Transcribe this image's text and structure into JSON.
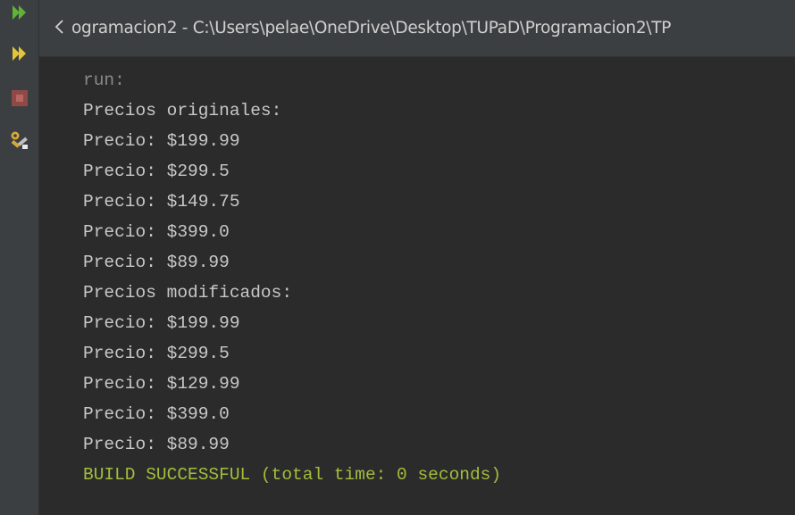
{
  "toolbar": {
    "buttons": [
      {
        "name": "rerun-icon",
        "color": "#5fb336"
      },
      {
        "name": "rerun-with-arguments-icon",
        "color": "#e2c53b"
      },
      {
        "name": "stop-icon",
        "color": "#c75450"
      },
      {
        "name": "settings-tools-icon",
        "color": "#d6a93a"
      }
    ]
  },
  "tab": {
    "title": "ogramacion2 - C:\\Users\\pelae\\OneDrive\\Desktop\\TUPaD\\Programacion2\\TP",
    "chevron_icon": "chevron-left-icon"
  },
  "output": {
    "lines": [
      {
        "text": "run:",
        "kind": "muted"
      },
      {
        "text": "Precios originales:",
        "kind": "std"
      },
      {
        "text": "Precio: $199.99",
        "kind": "std"
      },
      {
        "text": "Precio: $299.5",
        "kind": "std"
      },
      {
        "text": "Precio: $149.75",
        "kind": "std"
      },
      {
        "text": "Precio: $399.0",
        "kind": "std"
      },
      {
        "text": "Precio: $89.99",
        "kind": "std"
      },
      {
        "text": "Precios modificados:",
        "kind": "std"
      },
      {
        "text": "Precio: $199.99",
        "kind": "std"
      },
      {
        "text": "Precio: $299.5",
        "kind": "std"
      },
      {
        "text": "Precio: $129.99",
        "kind": "std"
      },
      {
        "text": "Precio: $399.0",
        "kind": "std"
      },
      {
        "text": "Precio: $89.99",
        "kind": "std"
      },
      {
        "text": "BUILD SUCCESSFUL (total time: 0 seconds)",
        "kind": "ok"
      }
    ]
  },
  "colors": {
    "panel_background": "#3c3f41",
    "console_background": "#2b2b2b",
    "console_text": "#c8c8c8",
    "console_muted": "#8a8a8a",
    "build_success": "#a4bd3c"
  }
}
